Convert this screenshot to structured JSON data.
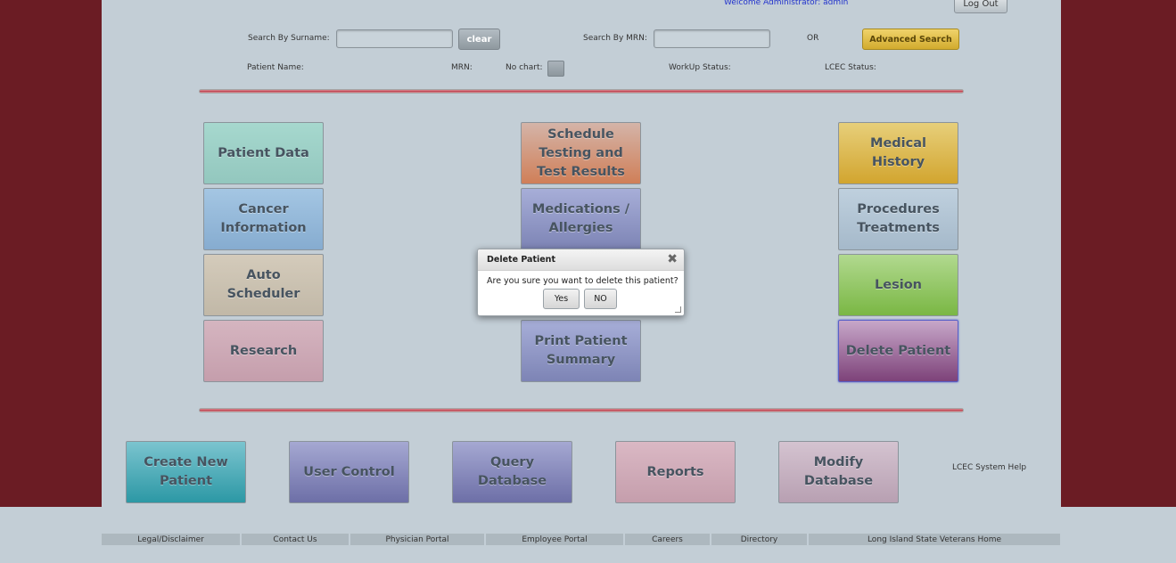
{
  "header": {
    "welcome": "Welcome Administrator: admin",
    "logout_label": "Log Out"
  },
  "search": {
    "surname_label": "Search By Surname:",
    "surname_value": "",
    "clear_label": "clear",
    "mrn_label": "Search By MRN:",
    "mrn_value": "",
    "or_label": "OR",
    "advanced_label": "Advanced Search"
  },
  "patient_info": {
    "name_label": "Patient Name:",
    "mrn_label": "MRN:",
    "nochart_label": "No chart:",
    "workup_label": "WorkUp Status:",
    "lcec_label": "LCEC Status:"
  },
  "tiles": {
    "patient_data": "Patient Data",
    "schedule": "Schedule Testing and Test Results",
    "medical_history": "Medical History",
    "cancer_info": "Cancer Information",
    "medications": "Medications / Allergies",
    "procedures": "Procedures Treatments",
    "auto_scheduler": "Auto Scheduler",
    "lesion": "Lesion",
    "research": "Research",
    "print_summary": "Print Patient Summary",
    "delete_patient": "Delete Patient"
  },
  "bottom_nav": {
    "create": "Create New Patient",
    "user_control": "User Control",
    "query": "Query Database",
    "reports": "Reports",
    "modify": "Modify Database",
    "help": "LCEC System Help"
  },
  "footer": {
    "links": [
      "Legal/Disclaimer",
      "Contact Us",
      "Physician Portal",
      "Employee Portal",
      "Careers",
      "Directory",
      "Long Island State Veterans Home"
    ]
  },
  "dialog": {
    "title": "Delete Patient",
    "message": "Are you sure you want to delete this patient?",
    "yes_label": "Yes",
    "no_label": "NO",
    "close_icon": "close-icon"
  }
}
